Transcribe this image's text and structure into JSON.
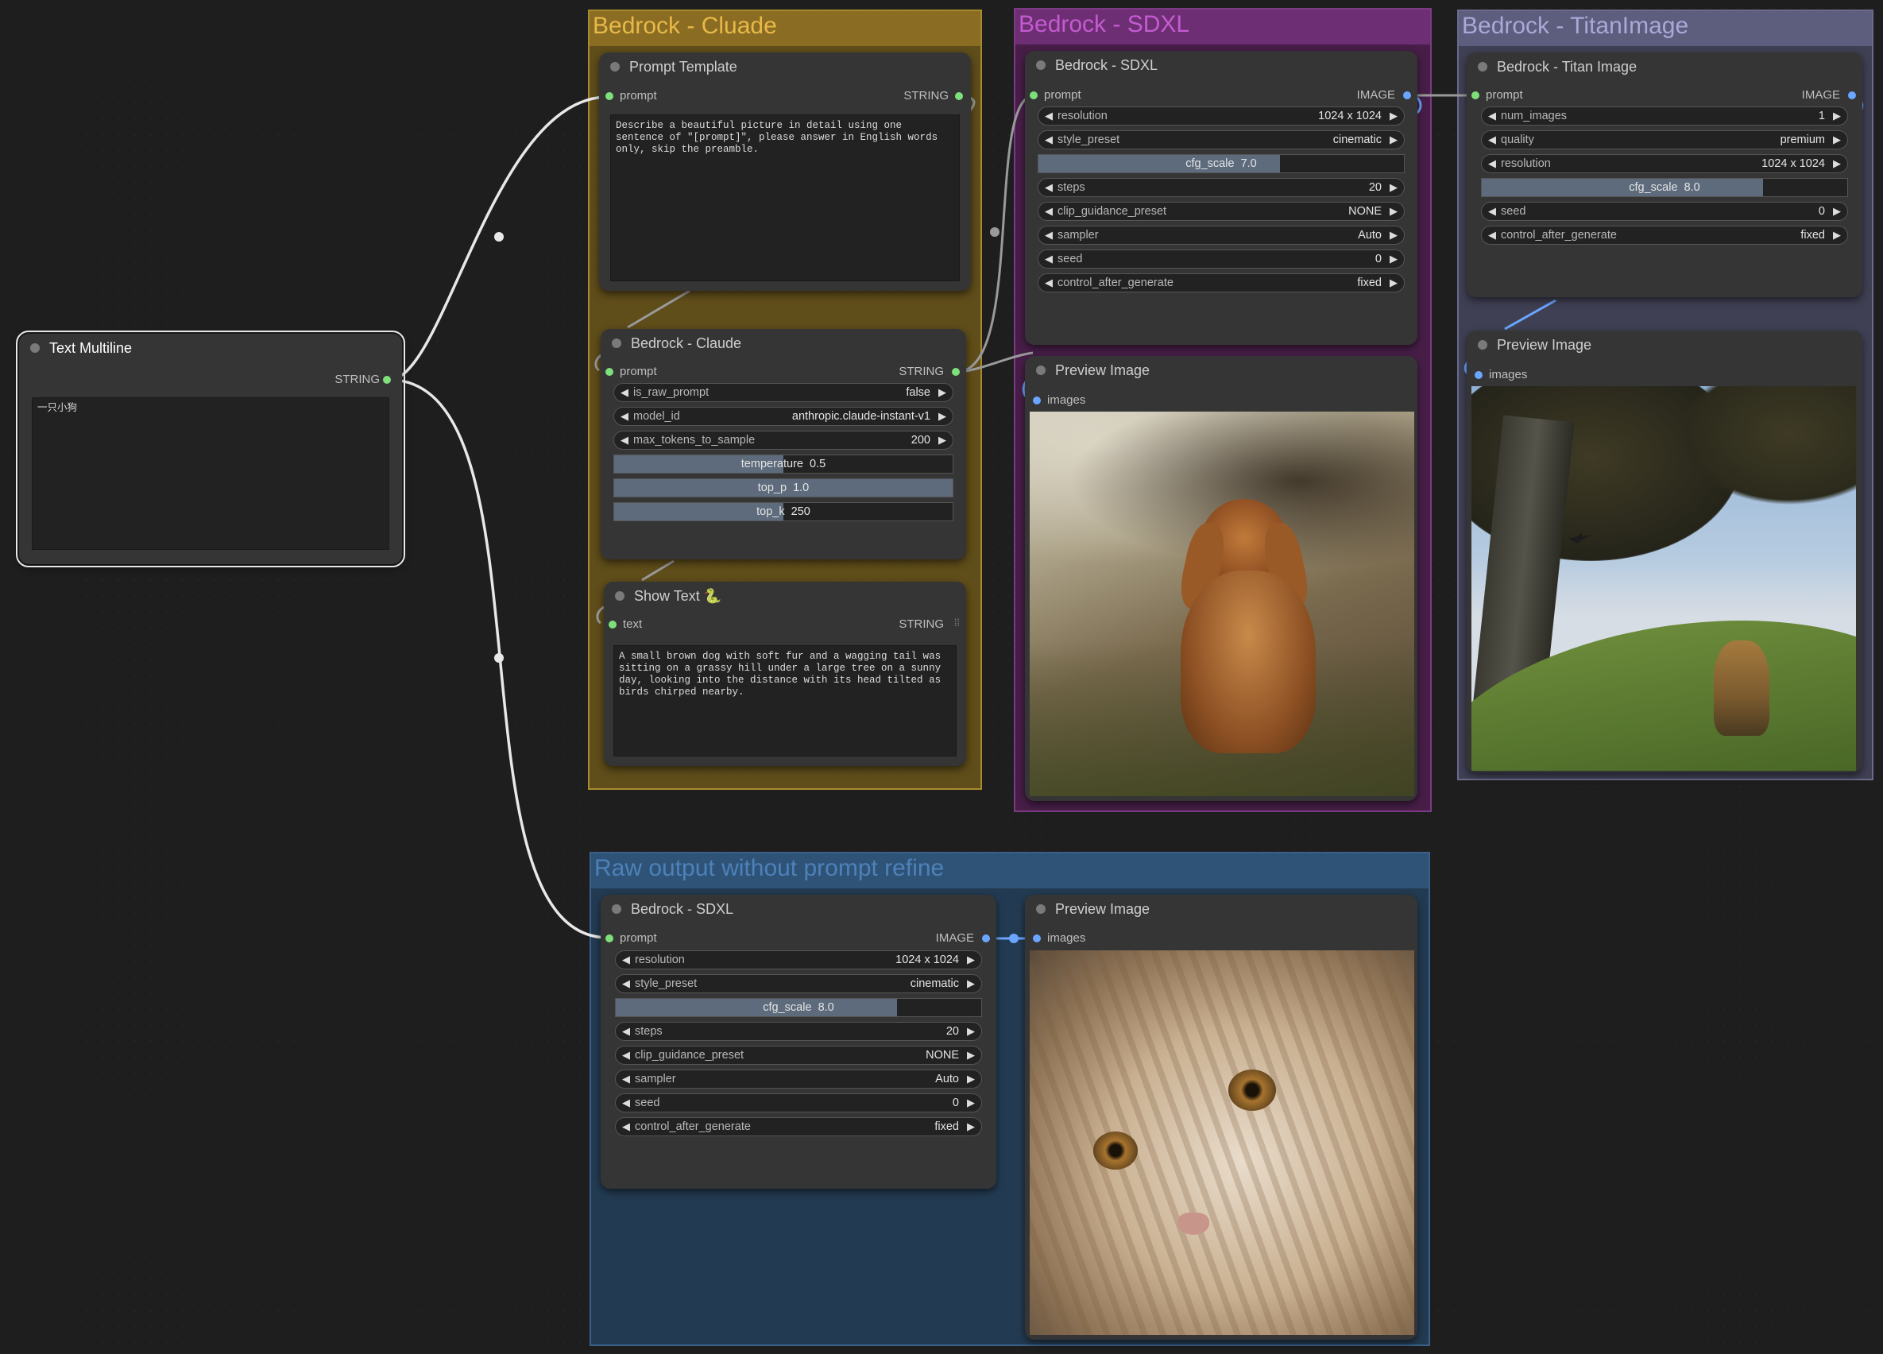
{
  "groups": {
    "claude": "Bedrock - Cluade",
    "sdxl": "Bedrock - SDXL",
    "titan": "Bedrock - TitanImage",
    "raw": "Raw output without prompt refine"
  },
  "text_multiline": {
    "title": "Text Multiline",
    "output": "STRING",
    "value": "一只小狗"
  },
  "prompt_template": {
    "title": "Prompt Template",
    "input": "prompt",
    "output": "STRING",
    "value": "Describe a beautiful picture in detail using one sentence of \"[prompt]\", please answer in English words only, skip the preamble."
  },
  "bedrock_claude": {
    "title": "Bedrock - Claude",
    "input": "prompt",
    "output": "STRING",
    "widgets": [
      {
        "label": "is_raw_prompt",
        "value": "false"
      },
      {
        "label": "model_id",
        "value": "anthropic.claude-instant-v1"
      },
      {
        "label": "max_tokens_to_sample",
        "value": "200"
      }
    ],
    "sliders": [
      {
        "label": "temperature",
        "value": "0.5",
        "fraction": 0.5
      },
      {
        "label": "top_p",
        "value": "1.0",
        "fraction": 1.0
      },
      {
        "label": "top_k",
        "value": "250",
        "fraction": 0.5
      }
    ]
  },
  "show_text": {
    "title": "Show Text 🐍",
    "input": "text",
    "output": "STRING",
    "value": "A small brown dog with soft fur and a wagging tail was sitting on a grassy hill under a large tree on a sunny day, looking into the distance with its head tilted as birds chirped nearby."
  },
  "sdxl": {
    "title": "Bedrock - SDXL",
    "input": "prompt",
    "output": "IMAGE",
    "w1": [
      {
        "label": "resolution",
        "value": "1024 x 1024"
      },
      {
        "label": "style_preset",
        "value": "cinematic"
      }
    ],
    "slider": {
      "label": "cfg_scale",
      "value": "7.0",
      "fraction": 0.66
    },
    "w2": [
      {
        "label": "steps",
        "value": "20"
      },
      {
        "label": "clip_guidance_preset",
        "value": "NONE"
      },
      {
        "label": "sampler",
        "value": "Auto"
      },
      {
        "label": "seed",
        "value": "0"
      },
      {
        "label": "control_after_generate",
        "value": "fixed"
      }
    ]
  },
  "preview_sdxl": {
    "title": "Preview Image",
    "input": "images"
  },
  "titan": {
    "title": "Bedrock - Titan Image",
    "input": "prompt",
    "output": "IMAGE",
    "w1": [
      {
        "label": "num_images",
        "value": "1"
      },
      {
        "label": "quality",
        "value": "premium"
      },
      {
        "label": "resolution",
        "value": "1024 x 1024"
      }
    ],
    "slider": {
      "label": "cfg_scale",
      "value": "8.0",
      "fraction": 0.77
    },
    "w2": [
      {
        "label": "seed",
        "value": "0"
      },
      {
        "label": "control_after_generate",
        "value": "fixed"
      }
    ]
  },
  "preview_titan": {
    "title": "Preview Image",
    "input": "images"
  },
  "raw_sdxl": {
    "title": "Bedrock - SDXL",
    "input": "prompt",
    "output": "IMAGE",
    "w1": [
      {
        "label": "resolution",
        "value": "1024 x 1024"
      },
      {
        "label": "style_preset",
        "value": "cinematic"
      }
    ],
    "slider": {
      "label": "cfg_scale",
      "value": "8.0",
      "fraction": 0.77
    },
    "w2": [
      {
        "label": "steps",
        "value": "20"
      },
      {
        "label": "clip_guidance_preset",
        "value": "NONE"
      },
      {
        "label": "sampler",
        "value": "Auto"
      },
      {
        "label": "seed",
        "value": "0"
      },
      {
        "label": "control_after_generate",
        "value": "fixed"
      }
    ]
  },
  "preview_raw": {
    "title": "Preview Image",
    "input": "images"
  }
}
